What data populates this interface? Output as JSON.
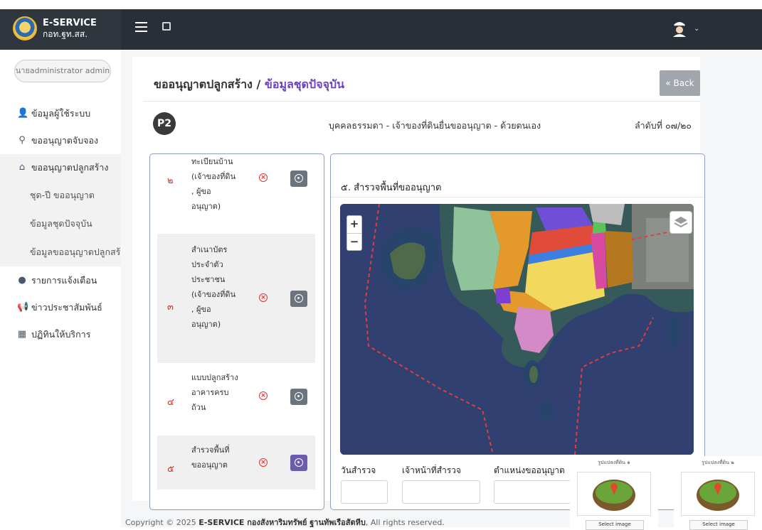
{
  "app": {
    "title": "E-SERVICE",
    "subtitle": "กอท.ฐท.สส."
  },
  "sidebar": {
    "user": "นายadministrator admin",
    "items": [
      {
        "label": "ข้อมูลผู้ใช้ระบบ",
        "icon": "user-icon"
      },
      {
        "label": "ขออนุญาตจับจอง",
        "icon": "map-pin-icon"
      },
      {
        "label": "ขออนุญาตปลูกสร้าง",
        "icon": "home-icon"
      },
      {
        "label": "รายการแจ้งเตือน",
        "icon": "alert-icon"
      },
      {
        "label": "ข่าวประชาสัมพันธ์",
        "icon": "megaphone-icon"
      },
      {
        "label": "ปฏิทินให้บริการ",
        "icon": "calendar-icon"
      }
    ],
    "submenu": [
      {
        "label": "ชุด-ปี ขออนุญาต"
      },
      {
        "label": "ข้อมูลชุดปัจจุบัน"
      },
      {
        "label": "ข้อมูลขออนุญาตปลูกสร้าง"
      }
    ]
  },
  "header": {
    "title_main": "ขออนุญาตปลูกสร้าง / ",
    "title_highlight": "ข้อมูลชุดปัจจุบัน",
    "back_label": "« Back"
  },
  "section": {
    "badge": "P2",
    "subtitle": "บุคคลธรรมดา - เจ้าของที่ดินยื่นขออนุญาต - ด้วยตนเอง",
    "sequence": "ลำดับที่ ๐๗/๒๐"
  },
  "documents": [
    {
      "num": "๒",
      "label": "ทะเบียนบ้าน (เจ้าของที่ดิน , ผู้ขออนุญาต)"
    },
    {
      "num": "๓",
      "label": "สำเนาบัตรประจำตัวประชาชน (เจ้าของที่ดิน , ผู้ขออนุญาต)"
    },
    {
      "num": "๔",
      "label": "แบบปลูกสร้างอาคารครบถ้วน"
    },
    {
      "num": "๕",
      "label": "สำรวจพื้นที่ขออนุญาต"
    }
  ],
  "map_section": {
    "title": "๕. สำรวจพื้นที่ขออนุญาต",
    "zoom_in": "+",
    "zoom_out": "−"
  },
  "survey_fields": [
    {
      "label": "วันสำรวจ",
      "value": ""
    },
    {
      "label": "เจ้าหน้าที่สำรวจ",
      "value": ""
    },
    {
      "label": "ตำแหน่งขออนุญาต",
      "value": ""
    }
  ],
  "image_cards": [
    {
      "caption": "รูปแปลงที่ดิน ๑",
      "button": "Select image"
    },
    {
      "caption": "รูปแปลงที่ดิน ๒",
      "button": "Select image"
    }
  ],
  "footer": {
    "prefix": "Copyright © 2025 ",
    "brand": "E-SERVICE กองสังหาริมทรัพย์ ฐานทัพเรือสัตหีบ",
    "suffix": ", All rights reserved."
  }
}
